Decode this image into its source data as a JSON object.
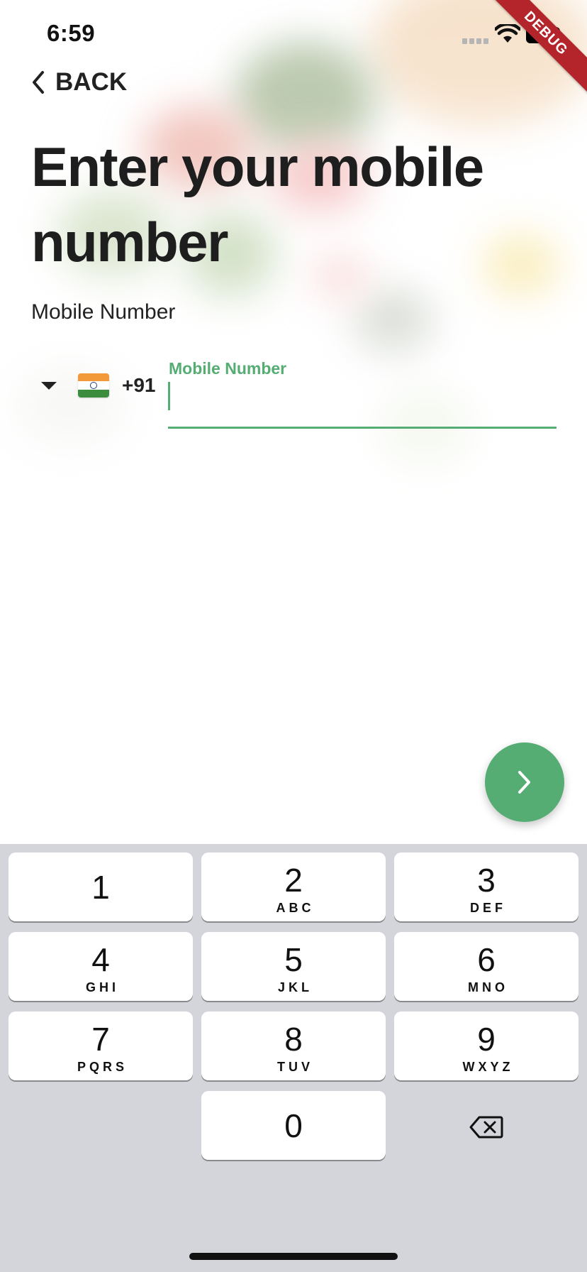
{
  "status_bar": {
    "time": "6:59",
    "debug_banner": "DEBUG"
  },
  "nav": {
    "back_label": "BACK"
  },
  "page": {
    "title": "Enter your mobile number",
    "section_label": "Mobile Number"
  },
  "phone_input": {
    "country_code": "+91",
    "country_flag": "india-flag",
    "floating_label": "Mobile Number",
    "value": "",
    "accent_color": "#55ad74"
  },
  "next_button": {
    "icon": "chevron-right-icon",
    "color": "#55ad74"
  },
  "keypad": {
    "keys": [
      {
        "digit": "1",
        "letters": ""
      },
      {
        "digit": "2",
        "letters": "ABC"
      },
      {
        "digit": "3",
        "letters": "DEF"
      },
      {
        "digit": "4",
        "letters": "GHI"
      },
      {
        "digit": "5",
        "letters": "JKL"
      },
      {
        "digit": "6",
        "letters": "MNO"
      },
      {
        "digit": "7",
        "letters": "PQRS"
      },
      {
        "digit": "8",
        "letters": "TUV"
      },
      {
        "digit": "9",
        "letters": "WXYZ"
      },
      {
        "digit": "0",
        "letters": ""
      }
    ],
    "delete_icon": "backspace-icon"
  }
}
